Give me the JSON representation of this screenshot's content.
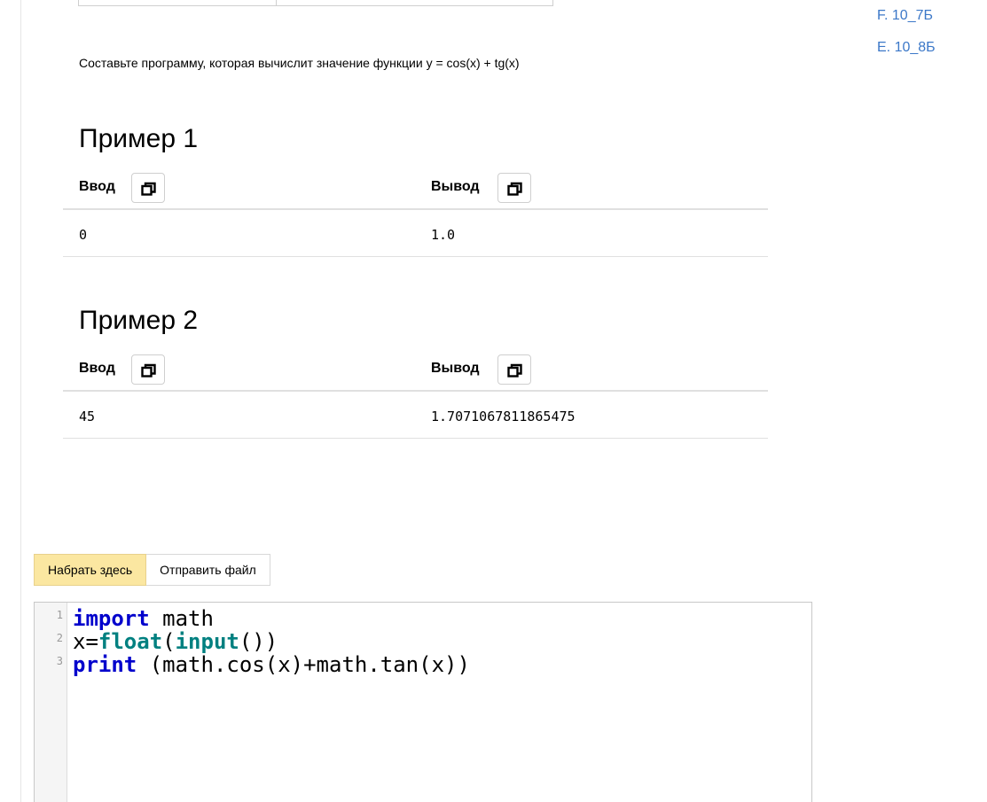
{
  "nav": {
    "links": [
      "F. 10_7Б",
      "E. 10_8Б"
    ]
  },
  "problem": {
    "statement": "Составьте программу, которая вычислит значение функции y = cos(x) + tg(x)"
  },
  "examples": [
    {
      "title": "Пример 1",
      "input_label": "Ввод",
      "output_label": "Вывод",
      "input": "0",
      "output": "1.0"
    },
    {
      "title": "Пример 2",
      "input_label": "Ввод",
      "output_label": "Вывод",
      "input": "45",
      "output": "1.7071067811865475"
    }
  ],
  "tabs": {
    "type_here": "Набрать здесь",
    "send_file": "Отправить файл"
  },
  "editor": {
    "line_numbers": [
      "1",
      "2",
      "3"
    ],
    "line1": {
      "kw": "import",
      "rest": " math"
    },
    "line2": {
      "a": "x=",
      "b1": "float",
      "c": "(",
      "b2": "input",
      "d": "())"
    },
    "line3": {
      "kw": "print",
      "rest": " (math.cos(x)+math.tan(x))"
    }
  },
  "colors": {
    "link": "#3c78c8",
    "active_tab": "#fbe7a1",
    "keyword": "#0000cc",
    "builtin": "#008080"
  },
  "icons": [
    "copy-icon"
  ]
}
